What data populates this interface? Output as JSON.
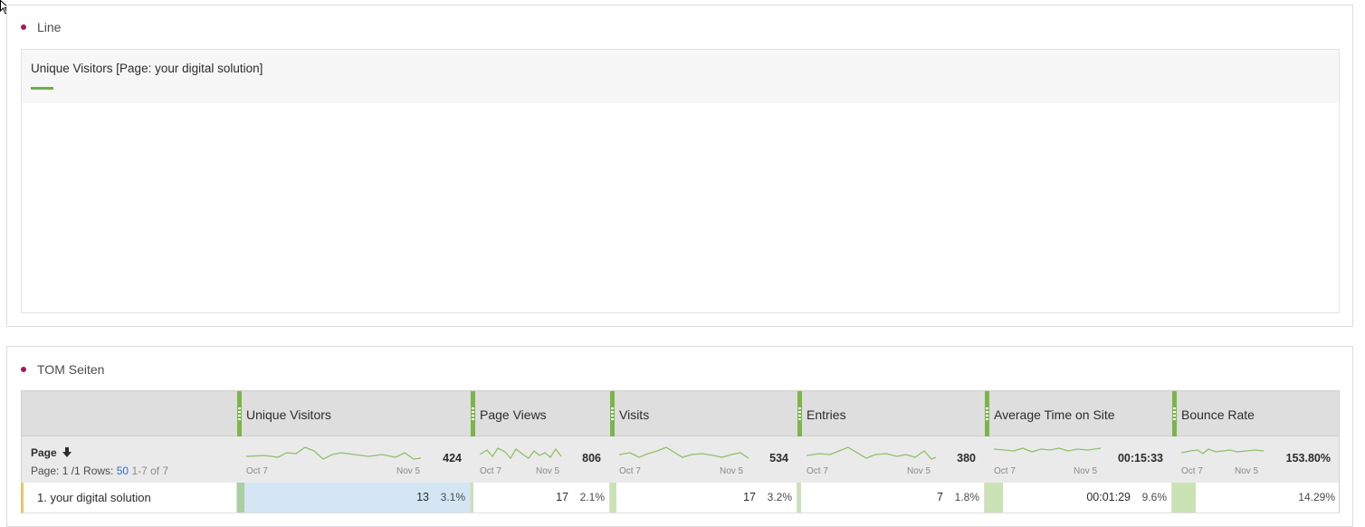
{
  "line_panel": {
    "title": "Line",
    "legend_series": "Unique Visitors [Page: your digital solution]",
    "series_color": "#6ab04c"
  },
  "table_panel": {
    "title": "TOM Seiten",
    "dimension": {
      "name": "Page",
      "sort_icon": "arrow-down-icon",
      "pager_prefix": "Page: 1 /1  Rows:",
      "rows": "50",
      "range": "1-7 of 7"
    },
    "columns": [
      {
        "label": "Unique Visitors",
        "total": "424",
        "date_start": "Oct 7",
        "date_end": "Nov 5"
      },
      {
        "label": "Page Views",
        "total": "806",
        "date_start": "Oct 7",
        "date_end": "Nov 5"
      },
      {
        "label": "Visits",
        "total": "534",
        "date_start": "Oct 7",
        "date_end": "Nov 5"
      },
      {
        "label": "Entries",
        "total": "380",
        "date_start": "Oct 7",
        "date_end": "Nov 5"
      },
      {
        "label": "Average Time on Site",
        "total": "00:15:33",
        "date_start": "Oct 7",
        "date_end": "Nov 5"
      },
      {
        "label": "Bounce Rate",
        "total": "153.80%",
        "date_start": "Oct 7",
        "date_end": "Nov 5"
      }
    ],
    "rows": [
      {
        "label": "1. your digital solution",
        "cells": [
          {
            "value": "13",
            "pct": "3.1%",
            "share": 0.031
          },
          {
            "value": "17",
            "pct": "2.1%",
            "share": 0.021
          },
          {
            "value": "17",
            "pct": "3.2%",
            "share": 0.032
          },
          {
            "value": "7",
            "pct": "1.8%",
            "share": 0.018
          },
          {
            "value": "00:01:29",
            "pct": "9.6%",
            "share": 0.096
          },
          {
            "value": "",
            "pct": "14.29%",
            "share": 0.1429
          }
        ]
      }
    ],
    "accent_color": "#7ab648",
    "selected_fill": "#d4e6f4",
    "bar_fill": "#c9e3b4",
    "row_marker_color": "#e9c46a"
  }
}
